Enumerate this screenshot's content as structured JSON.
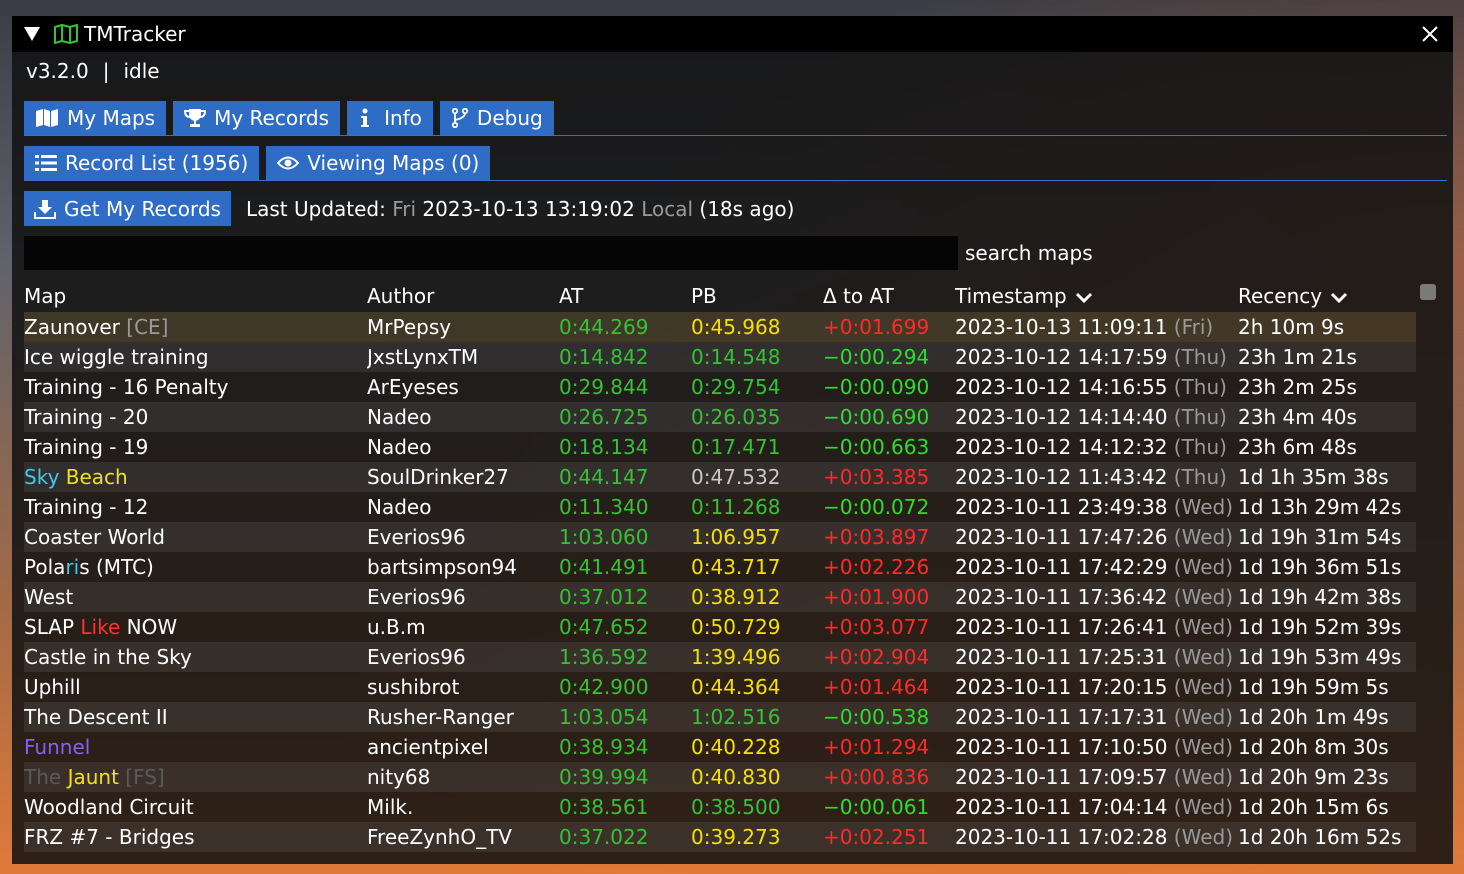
{
  "window": {
    "title": "TMTracker",
    "version": "v3.2.0",
    "status": "idle",
    "status_sep": "|"
  },
  "tabs": [
    {
      "label": "My Maps",
      "icon": "map-icon"
    },
    {
      "label": "My Records",
      "icon": "trophy-icon"
    },
    {
      "label": "Info",
      "icon": "info-icon"
    },
    {
      "label": "Debug",
      "icon": "code-branch-icon"
    }
  ],
  "subtabs": [
    {
      "label": "Record List (1956)",
      "icon": "list-icon"
    },
    {
      "label": "Viewing Maps (0)",
      "icon": "eye-icon"
    }
  ],
  "actions": {
    "get_records": "Get My Records",
    "last_updated_label": "Last Updated:",
    "last_updated_day": "Fri",
    "last_updated_time": "2023-10-13 13:19:02",
    "last_updated_zone": "Local",
    "last_updated_ago": "(18s ago)"
  },
  "search": {
    "label": "search maps",
    "value": ""
  },
  "columns": [
    "Map",
    "Author",
    "AT",
    "PB",
    "Δ to AT",
    "Timestamp",
    "Recency"
  ],
  "colors": {
    "accent": "#2f6cc5",
    "at": "#35c235",
    "pb_gold": "#f5e100",
    "pb_gray": "#c8c8c8",
    "delta_pos": "#ff2a2a",
    "delta_neg": "#2cde2c",
    "map_cyan": "#3fc8f0",
    "map_yellow": "#f0e020",
    "map_red": "#ff3030",
    "map_purple": "#8a5ff0"
  },
  "rows": [
    {
      "map": [
        [
          "Zaunover ",
          ""
        ],
        [
          "[CE]",
          "muted"
        ]
      ],
      "author": "MrPepsy",
      "at": "0:44.269",
      "pb": "0:45.968",
      "pb_color": "yellow",
      "delta": "+0:01.699",
      "delta_color": "red",
      "ts": "2023-10-13 11:09:11",
      "day": "(Fri)",
      "recency": "2h 10m 9s"
    },
    {
      "map": [
        [
          "Ice wiggle training",
          ""
        ]
      ],
      "author": "JxstLynxTM",
      "at": "0:14.842",
      "pb": "0:14.548",
      "pb_color": "green",
      "delta": "−0:00.294",
      "delta_color": "bgreen",
      "ts": "2023-10-12 14:17:59",
      "day": "(Thu)",
      "recency": "23h 1m 21s"
    },
    {
      "map": [
        [
          "Training - 16 Penalty",
          ""
        ]
      ],
      "author": "ArEyeses",
      "at": "0:29.844",
      "pb": "0:29.754",
      "pb_color": "green",
      "delta": "−0:00.090",
      "delta_color": "bgreen",
      "ts": "2023-10-12 14:16:55",
      "day": "(Thu)",
      "recency": "23h 2m 25s"
    },
    {
      "map": [
        [
          "Training - 20",
          ""
        ]
      ],
      "author": "Nadeo",
      "at": "0:26.725",
      "pb": "0:26.035",
      "pb_color": "green",
      "delta": "−0:00.690",
      "delta_color": "bgreen",
      "ts": "2023-10-12 14:14:40",
      "day": "(Thu)",
      "recency": "23h 4m 40s"
    },
    {
      "map": [
        [
          "Training - 19",
          ""
        ]
      ],
      "author": "Nadeo",
      "at": "0:18.134",
      "pb": "0:17.471",
      "pb_color": "green",
      "delta": "−0:00.663",
      "delta_color": "bgreen",
      "ts": "2023-10-12 14:12:32",
      "day": "(Thu)",
      "recency": "23h 6m 48s"
    },
    {
      "map": [
        [
          "Sky ",
          "cyan"
        ],
        [
          "Beach",
          "yellow"
        ]
      ],
      "author": "SoulDrinker27",
      "at": "0:44.147",
      "pb": "0:47.532",
      "pb_color": "gray",
      "delta": "+0:03.385",
      "delta_color": "red",
      "ts": "2023-10-12 11:43:42",
      "day": "(Thu)",
      "recency": "1d 1h 35m 38s"
    },
    {
      "map": [
        [
          "Training - 12",
          ""
        ]
      ],
      "author": "Nadeo",
      "at": "0:11.340",
      "pb": "0:11.268",
      "pb_color": "green",
      "delta": "−0:00.072",
      "delta_color": "bgreen",
      "ts": "2023-10-11 23:49:38",
      "day": "(Wed)",
      "recency": "1d 13h 29m 42s"
    },
    {
      "map": [
        [
          "Coaster World",
          ""
        ]
      ],
      "author": "Everios96",
      "at": "1:03.060",
      "pb": "1:06.957",
      "pb_color": "yellow",
      "delta": "+0:03.897",
      "delta_color": "red",
      "ts": "2023-10-11 17:47:26",
      "day": "(Wed)",
      "recency": "1d 19h 31m 54s"
    },
    {
      "map": [
        [
          "Pola",
          ""
        ],
        [
          "ri",
          "cyan"
        ],
        [
          "s (MTC)",
          ""
        ]
      ],
      "author": "bartsimpson94",
      "at": "0:41.491",
      "pb": "0:43.717",
      "pb_color": "yellow",
      "delta": "+0:02.226",
      "delta_color": "red",
      "ts": "2023-10-11 17:42:29",
      "day": "(Wed)",
      "recency": "1d 19h 36m 51s"
    },
    {
      "map": [
        [
          "West",
          ""
        ]
      ],
      "author": "Everios96",
      "at": "0:37.012",
      "pb": "0:38.912",
      "pb_color": "yellow",
      "delta": "+0:01.900",
      "delta_color": "red",
      "ts": "2023-10-11 17:36:42",
      "day": "(Wed)",
      "recency": "1d 19h 42m 38s"
    },
    {
      "map": [
        [
          "SLAP ",
          ""
        ],
        [
          "Like",
          "red"
        ],
        [
          " NOW",
          ""
        ]
      ],
      "author": "u.B.m",
      "at": "0:47.652",
      "pb": "0:50.729",
      "pb_color": "yellow",
      "delta": "+0:03.077",
      "delta_color": "red",
      "ts": "2023-10-11 17:26:41",
      "day": "(Wed)",
      "recency": "1d 19h 52m 39s"
    },
    {
      "map": [
        [
          "Castle in the Sky",
          ""
        ]
      ],
      "author": "Everios96",
      "at": "1:36.592",
      "pb": "1:39.496",
      "pb_color": "yellow",
      "delta": "+0:02.904",
      "delta_color": "red",
      "ts": "2023-10-11 17:25:31",
      "day": "(Wed)",
      "recency": "1d 19h 53m 49s"
    },
    {
      "map": [
        [
          "Uphill",
          ""
        ]
      ],
      "author": "sushibrot",
      "at": "0:42.900",
      "pb": "0:44.364",
      "pb_color": "yellow",
      "delta": "+0:01.464",
      "delta_color": "red",
      "ts": "2023-10-11 17:20:15",
      "day": "(Wed)",
      "recency": "1d 19h 59m 5s"
    },
    {
      "map": [
        [
          "The Descent II",
          ""
        ]
      ],
      "author": "Rusher-Ranger",
      "at": "1:03.054",
      "pb": "1:02.516",
      "pb_color": "green",
      "delta": "−0:00.538",
      "delta_color": "bgreen",
      "ts": "2023-10-11 17:17:31",
      "day": "(Wed)",
      "recency": "1d 20h 1m 49s"
    },
    {
      "map": [
        [
          "Funnel",
          "purple"
        ]
      ],
      "author": "ancientpixel",
      "at": "0:38.934",
      "pb": "0:40.228",
      "pb_color": "yellow",
      "delta": "+0:01.294",
      "delta_color": "red",
      "ts": "2023-10-11 17:10:50",
      "day": "(Wed)",
      "recency": "1d 20h 8m 30s"
    },
    {
      "map": [
        [
          "The ",
          "dark"
        ],
        [
          "Jaunt",
          "yellow"
        ],
        [
          " [FS]",
          "dark"
        ]
      ],
      "author": "nity68",
      "at": "0:39.994",
      "pb": "0:40.830",
      "pb_color": "yellow",
      "delta": "+0:00.836",
      "delta_color": "red",
      "ts": "2023-10-11 17:09:57",
      "day": "(Wed)",
      "recency": "1d 20h 9m 23s"
    },
    {
      "map": [
        [
          "Woodland Circuit",
          ""
        ]
      ],
      "author": "Milk.",
      "at": "0:38.561",
      "pb": "0:38.500",
      "pb_color": "green",
      "delta": "−0:00.061",
      "delta_color": "bgreen",
      "ts": "2023-10-11 17:04:14",
      "day": "(Wed)",
      "recency": "1d 20h 15m 6s"
    },
    {
      "map": [
        [
          "FRZ #7 - Bridges",
          ""
        ]
      ],
      "author": "FreeZynhO_TV",
      "at": "0:37.022",
      "pb": "0:39.273",
      "pb_color": "yellow",
      "delta": "+0:02.251",
      "delta_color": "red",
      "ts": "2023-10-11 17:02:28",
      "day": "(Wed)",
      "recency": "1d 20h 16m 52s"
    }
  ]
}
